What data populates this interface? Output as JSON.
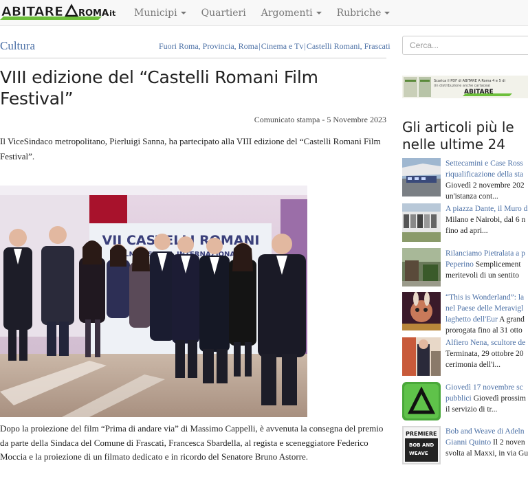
{
  "site": {
    "logo_text": "ABITARE",
    "logo_text2": "ROMA",
    "logo_tld": ".it"
  },
  "nav": {
    "items": [
      {
        "label": "Municipi",
        "dropdown": true
      },
      {
        "label": "Quartieri",
        "dropdown": false
      },
      {
        "label": "Argomenti",
        "dropdown": true
      },
      {
        "label": "Rubriche",
        "dropdown": true
      }
    ]
  },
  "article": {
    "section": "Cultura",
    "tags": [
      "Fuori Roma, Provincia, Roma",
      "Cinema e Tv",
      "Castelli Romani, Frascati"
    ],
    "title": "VIII edizione del “Castelli Romani Film Festival”",
    "byline": "Comunicato stampa - 5 Novembre 2023",
    "para1": "Il ViceSindaco metropolitano, Pierluigi Sanna, ha partecipato alla VIII edizione del “Castelli Romani Film Festival”.",
    "photo_banner_line1": "VII CASTELLI ROMANI",
    "photo_banner_line2": "FILM FESTIVAL INTERNAZIONALE",
    "para2": "Dopo la proiezione del film “Prima di andare via” di Massimo Cappelli, è avvenuta la consegna del premio da parte della Sindaca del Comune di Frascati, Francesca Sbardella, al regista e sceneggiatore Federico Moccia e la proiezione di un filmato dedicato e in ricordo del Senatore Bruno Astorre."
  },
  "sidebar": {
    "search_placeholder": "Cerca...",
    "banner_text": "Scarica il PDF di ABITARE A Roma 4 e 5 di",
    "banner_sub": "(in distribuzione anche cartacea)",
    "banner_logo": "ABITARE",
    "heading_line1": "Gli articoli più le",
    "heading_line2": "nelle ultime 24",
    "articles": [
      {
        "title_lines": [
          "Settecamini e Case Ross",
          "riqualificazione della sta"
        ],
        "snippet_lines": [
          "Giovedì 2 novembre 202",
          "un'istanza cont..."
        ]
      },
      {
        "title_lines": [
          "A piazza Dante, il Muro d"
        ],
        "snippet_lines": [
          "Milano e Nairobi, dal 6 n",
          "fino ad apri..."
        ]
      },
      {
        "title_lines": [
          "Rilanciamo Pietralata a p",
          "Peperino"
        ],
        "snippet_lines": [
          "Semplicement",
          "meritevoli di un sentito"
        ]
      },
      {
        "title_lines": [
          "“This is Wonderland”: la",
          "nel Paese delle Meravigl",
          "laghetto dell'Eur"
        ],
        "snippet_lines": [
          "A grand",
          "prorogata fino al 31 otto"
        ]
      },
      {
        "title_lines": [
          "Alfiero Nena, scultore de"
        ],
        "snippet_lines": [
          "Terminata, 29 ottobre 20",
          "cerimonia dell'i..."
        ]
      },
      {
        "title_lines": [
          "Giovedì 17 novembre sc",
          "pubblici"
        ],
        "snippet_lines": [
          "Giovedì prossim",
          "il servizio di tr..."
        ]
      },
      {
        "title_lines": [
          "Bob and Weave di Adeln",
          "Gianni Quinto"
        ],
        "snippet_lines": [
          "Il 2 noven",
          "svolta al Maxxi, in via Gu"
        ]
      }
    ],
    "thumb_labels": {
      "premiere": "PREMIERE",
      "bob": "BOB AND",
      "weave": "WEAVE"
    }
  },
  "colors": {
    "link": "#4a6fa5",
    "nav_bg": "#f8f8f8",
    "logo_green": "#6dbf3b"
  }
}
